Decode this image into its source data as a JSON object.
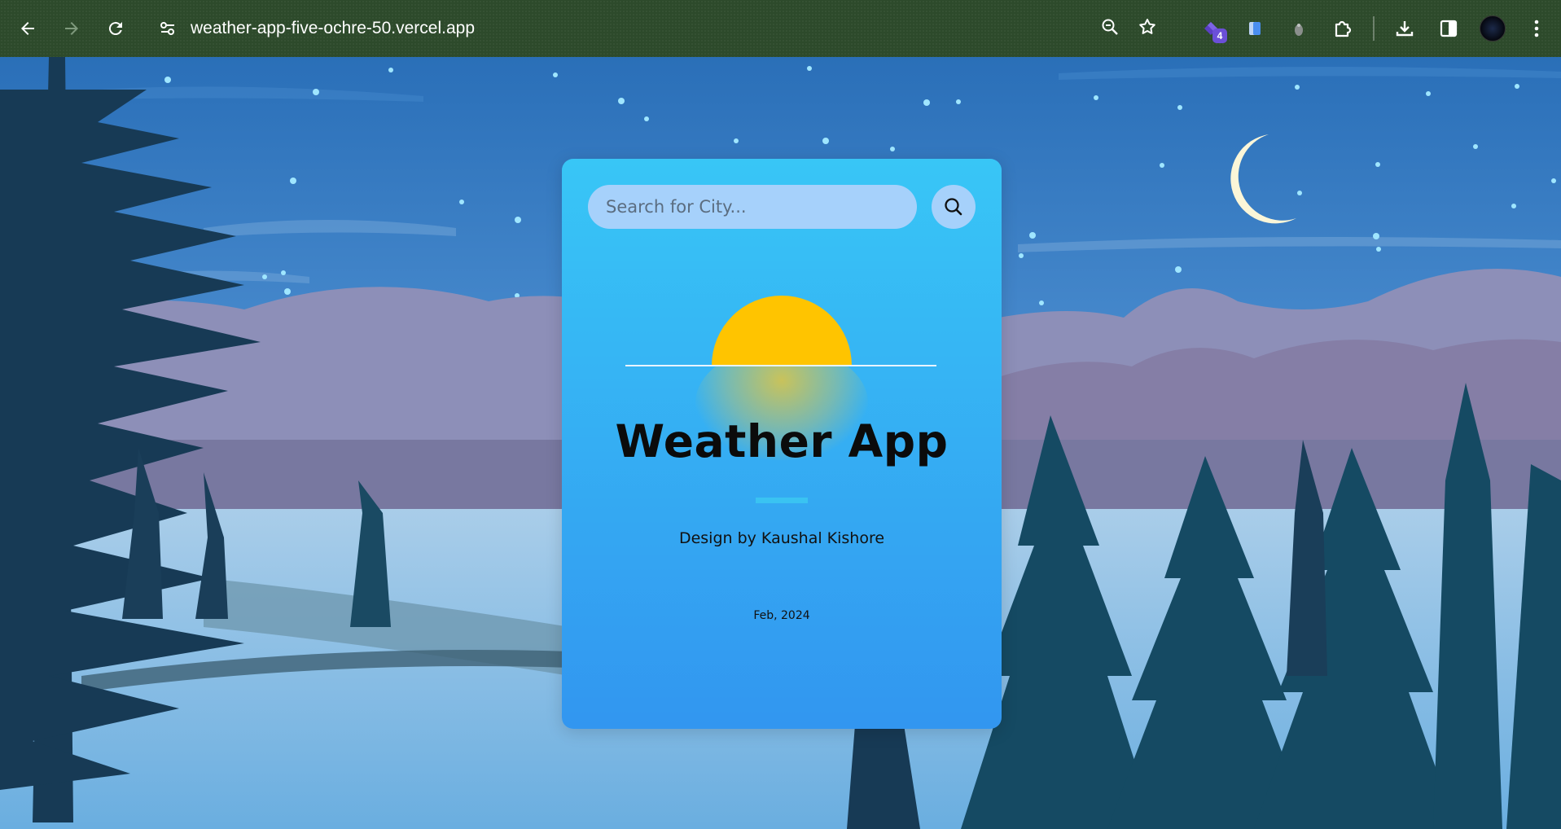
{
  "browser": {
    "url": "weather-app-five-ochre-50.vercel.app",
    "extension_badge": "4",
    "icons": [
      "back-icon",
      "forward-icon",
      "reload-icon",
      "site-settings-icon",
      "zoom-icon",
      "bookmark-star-icon",
      "extension-icon",
      "extension-icon",
      "extension-icon",
      "extensions-puzzle-icon",
      "download-icon",
      "side-panel-icon",
      "profile-avatar",
      "kebab-menu-icon"
    ]
  },
  "app": {
    "search_placeholder": "Search for City...",
    "search_value": "",
    "title": "Weather App",
    "credit": "Design by Kaushal Kishore",
    "date": "Feb, 2024"
  },
  "colors": {
    "card_top": "#38c6f6",
    "card_bottom": "#3296f0",
    "sun": "#ffc400",
    "search_bg": "#a6d1fb",
    "browser_bar": "#2d4a2b"
  }
}
